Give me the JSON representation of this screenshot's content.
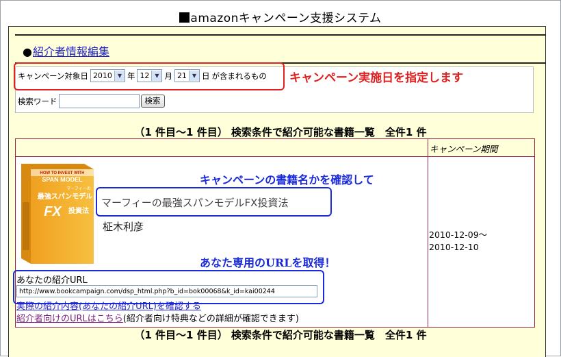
{
  "page_title": "amazonキャンペーン支援システム",
  "edit_link": "紹介者情報編集",
  "search": {
    "date_label": "キャンペーン対象日",
    "year": "2010",
    "year_unit": "年",
    "month": "12",
    "month_unit": "月",
    "day": "21",
    "day_unit": "日",
    "date_suffix": "が含まれるもの",
    "keyword_label": "検索ワード",
    "keyword_value": "",
    "search_button": "検索"
  },
  "annotation_red": "キャンペーン実施日を指定します",
  "result_count": "（1 件目〜1 件目） 検索条件で紹介可能な書籍一覧　全件1 件",
  "table": {
    "period_header": "キャンペーン期間"
  },
  "book": {
    "title": "マーフィーの最強スパンモデルFX投資法",
    "author": "柾木利彦",
    "period": [
      "2010-12-09〜",
      "2010-12-10"
    ],
    "cover_text": {
      "top": "HOW TO INVEST WITH",
      "top2": "SPAN MODEL",
      "subtitle": "マーフィーの",
      "main": "最強スパンモデル",
      "fx": "FX",
      "tail": "投資法"
    }
  },
  "annotation_blue_1": "キャンペーンの書籍名かを確認して",
  "annotation_blue_2": "あなた専用のURLを取得！",
  "url_label": "あなたの紹介URL",
  "url_value": "http://www.bookcampaign.com/dsp_html.php?b_id=bok00068&k_id=kai00244",
  "link_actual": "実際の紹介内容(あなたの紹介URL)を確認する",
  "link_referrer": "紹介者向けのURLはこちら",
  "link_referrer_note": "(紹介者向け特典などの詳細が確認できます)",
  "colors": {
    "panel_bg": "#ffffd9",
    "annotation_red": "#e02020",
    "annotation_blue": "#1a2ad8",
    "table_border": "#99284f"
  }
}
